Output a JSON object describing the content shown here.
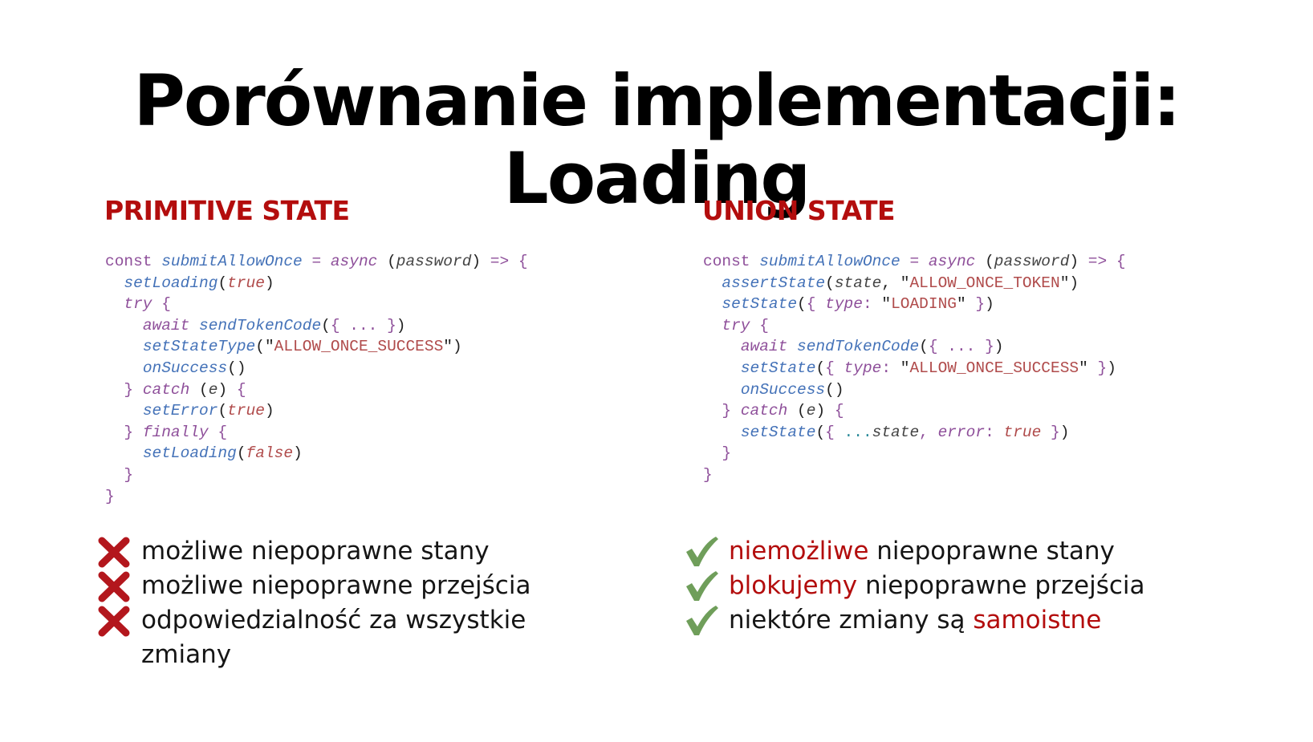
{
  "title": "Porównanie implementacji: Loading",
  "left": {
    "heading": "PRIMITIVE STATE",
    "code": [
      [
        [
          "k",
          "const "
        ],
        [
          "f",
          "submitAllowOnce"
        ],
        [
          "k",
          " = "
        ],
        [
          "ki",
          "async"
        ],
        [
          "pl",
          " ("
        ],
        [
          "p",
          "password"
        ],
        [
          "pl",
          ")"
        ],
        [
          "k",
          " => {"
        ]
      ],
      [
        [
          "t",
          "  "
        ],
        [
          "f",
          "setLoading"
        ],
        [
          "pl",
          "("
        ],
        [
          "b",
          "true"
        ],
        [
          "pl",
          ")"
        ]
      ],
      [
        [
          "t",
          "  "
        ],
        [
          "ki",
          "try"
        ],
        [
          "k",
          " {"
        ]
      ],
      [
        [
          "t",
          "    "
        ],
        [
          "ki",
          "await "
        ],
        [
          "f",
          "sendTokenCode"
        ],
        [
          "pl",
          "("
        ],
        [
          "k",
          "{ ... }"
        ],
        [
          "pl",
          ")"
        ]
      ],
      [
        [
          "t",
          "    "
        ],
        [
          "f",
          "setStateType"
        ],
        [
          "pl",
          "(\""
        ],
        [
          "s",
          "ALLOW_ONCE_SUCCESS"
        ],
        [
          "pl",
          "\")"
        ]
      ],
      [
        [
          "t",
          "    "
        ],
        [
          "f",
          "onSuccess"
        ],
        [
          "pl",
          "()"
        ]
      ],
      [
        [
          "t",
          "  "
        ],
        [
          "k",
          "} "
        ],
        [
          "ki",
          "catch"
        ],
        [
          "pl",
          " ("
        ],
        [
          "p",
          "e"
        ],
        [
          "pl",
          ")"
        ],
        [
          "k",
          " {"
        ]
      ],
      [
        [
          "t",
          "    "
        ],
        [
          "f",
          "setError"
        ],
        [
          "pl",
          "("
        ],
        [
          "b",
          "true"
        ],
        [
          "pl",
          ")"
        ]
      ],
      [
        [
          "t",
          "  "
        ],
        [
          "k",
          "} "
        ],
        [
          "ki",
          "finally"
        ],
        [
          "k",
          " {"
        ]
      ],
      [
        [
          "t",
          "    "
        ],
        [
          "f",
          "setLoading"
        ],
        [
          "pl",
          "("
        ],
        [
          "b",
          "false"
        ],
        [
          "pl",
          ")"
        ]
      ],
      [
        [
          "t",
          "  "
        ],
        [
          "k",
          "}"
        ]
      ],
      [
        [
          "k",
          "}"
        ]
      ]
    ],
    "bullets": [
      "możliwe niepoprawne stany",
      "możliwe niepoprawne przejścia",
      "odpowiedzialność za wszystkie zmiany"
    ]
  },
  "right": {
    "heading": "UNION STATE",
    "code": [
      [
        [
          "k",
          "const "
        ],
        [
          "f",
          "submitAllowOnce"
        ],
        [
          "k",
          " = "
        ],
        [
          "ki",
          "async"
        ],
        [
          "pl",
          " ("
        ],
        [
          "p",
          "password"
        ],
        [
          "pl",
          ")"
        ],
        [
          "k",
          " => {"
        ]
      ],
      [
        [
          "t",
          "  "
        ],
        [
          "f",
          "assertState"
        ],
        [
          "pl",
          "("
        ],
        [
          "p",
          "state"
        ],
        [
          "pl",
          ", \""
        ],
        [
          "s",
          "ALLOW_ONCE_TOKEN"
        ],
        [
          "pl",
          "\")"
        ]
      ],
      [
        [
          "t",
          "  "
        ],
        [
          "f",
          "setState"
        ],
        [
          "pl",
          "("
        ],
        [
          "k",
          "{ "
        ],
        [
          "ki",
          "type"
        ],
        [
          "k",
          ": "
        ],
        [
          "pl",
          "\""
        ],
        [
          "s",
          "LOADING"
        ],
        [
          "pl",
          "\""
        ],
        [
          "k",
          " }"
        ],
        [
          "pl",
          ")"
        ]
      ],
      [
        [
          "t",
          "  "
        ],
        [
          "ki",
          "try"
        ],
        [
          "k",
          " {"
        ]
      ],
      [
        [
          "t",
          "    "
        ],
        [
          "ki",
          "await "
        ],
        [
          "f",
          "sendTokenCode"
        ],
        [
          "pl",
          "("
        ],
        [
          "k",
          "{ ... }"
        ],
        [
          "pl",
          ")"
        ]
      ],
      [
        [
          "t",
          "    "
        ],
        [
          "f",
          "setState"
        ],
        [
          "pl",
          "("
        ],
        [
          "k",
          "{ "
        ],
        [
          "ki",
          "type"
        ],
        [
          "k",
          ": "
        ],
        [
          "pl",
          "\""
        ],
        [
          "s",
          "ALLOW_ONCE_SUCCESS"
        ],
        [
          "pl",
          "\""
        ],
        [
          "k",
          " }"
        ],
        [
          "pl",
          ")"
        ]
      ],
      [
        [
          "t",
          "    "
        ],
        [
          "f",
          "onSuccess"
        ],
        [
          "pl",
          "()"
        ]
      ],
      [
        [
          "t",
          "  "
        ],
        [
          "k",
          "} "
        ],
        [
          "ki",
          "catch"
        ],
        [
          "pl",
          " ("
        ],
        [
          "p",
          "e"
        ],
        [
          "pl",
          ")"
        ],
        [
          "k",
          " {"
        ]
      ],
      [
        [
          "t",
          "    "
        ],
        [
          "f",
          "setState"
        ],
        [
          "pl",
          "("
        ],
        [
          "k",
          "{ "
        ],
        [
          "cy",
          "..."
        ],
        [
          "p",
          "state"
        ],
        [
          "k",
          ", "
        ],
        [
          "ki",
          "error"
        ],
        [
          "k",
          ": "
        ],
        [
          "b",
          "true"
        ],
        [
          "k",
          " }"
        ],
        [
          "pl",
          ")"
        ]
      ],
      [
        [
          "t",
          "  "
        ],
        [
          "k",
          "}"
        ]
      ],
      [
        [
          "k",
          "}"
        ]
      ]
    ],
    "bullets": [
      [
        [
          "hl",
          "niemożliwe"
        ],
        [
          "n",
          " niepoprawne stany"
        ]
      ],
      [
        [
          "hl",
          "blokujemy"
        ],
        [
          "n",
          " niepoprawne przejścia"
        ]
      ],
      [
        [
          "n",
          "niektóre zmiany są "
        ],
        [
          "hl",
          "samoistne"
        ]
      ]
    ]
  },
  "colors": {
    "heading_red": "#b30d0d",
    "cross_red": "#b3171d",
    "check_green": "#6f9e5a",
    "highlight_red": "#b30d0d"
  },
  "icons": {
    "negative": "cross-icon",
    "positive": "check-icon"
  }
}
